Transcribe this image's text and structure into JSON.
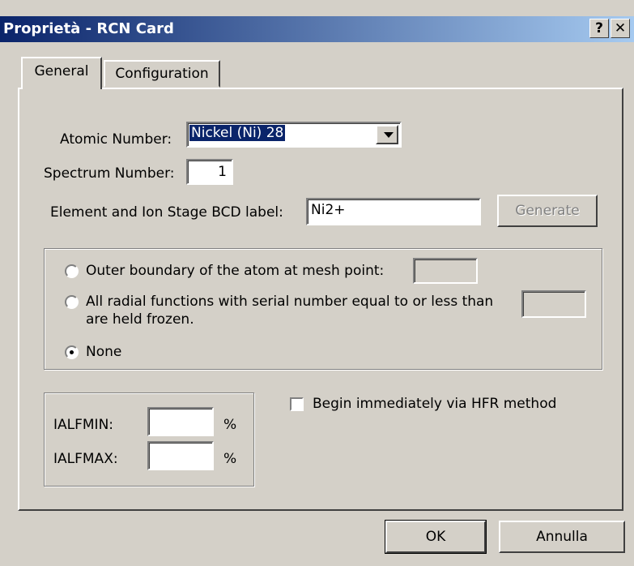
{
  "window": {
    "title": "Proprietà - RCN Card",
    "help_label": "?",
    "close_label": "✕"
  },
  "tabs": [
    {
      "label": "General"
    },
    {
      "label": "Configuration"
    }
  ],
  "general": {
    "atomic_number_label": "Atomic Number:",
    "atomic_number_value": "Nickel (Ni) 28",
    "spectrum_number_label": "Spectrum Number:",
    "spectrum_number_value": "1",
    "bcd_label": "Element and Ion Stage BCD label:",
    "bcd_value": "Ni2+",
    "generate_label": "Generate"
  },
  "boundary_group": {
    "option1_label": "Outer boundary of the atom at mesh point:",
    "option1_value": "",
    "option2_label": "All radial functions with serial number equal to or less than",
    "option2_label_line2": "are held frozen.",
    "option2_value": "",
    "option3_label": "None",
    "selected": "None"
  },
  "ialf": {
    "min_label": "IALFMIN:",
    "min_value": "",
    "max_label": "IALFMAX:",
    "max_value": "",
    "unit": "%"
  },
  "hfr": {
    "label": "Begin immediately via HFR method",
    "checked": false
  },
  "buttons": {
    "ok_label": "OK",
    "cancel_label": "Annulla"
  }
}
